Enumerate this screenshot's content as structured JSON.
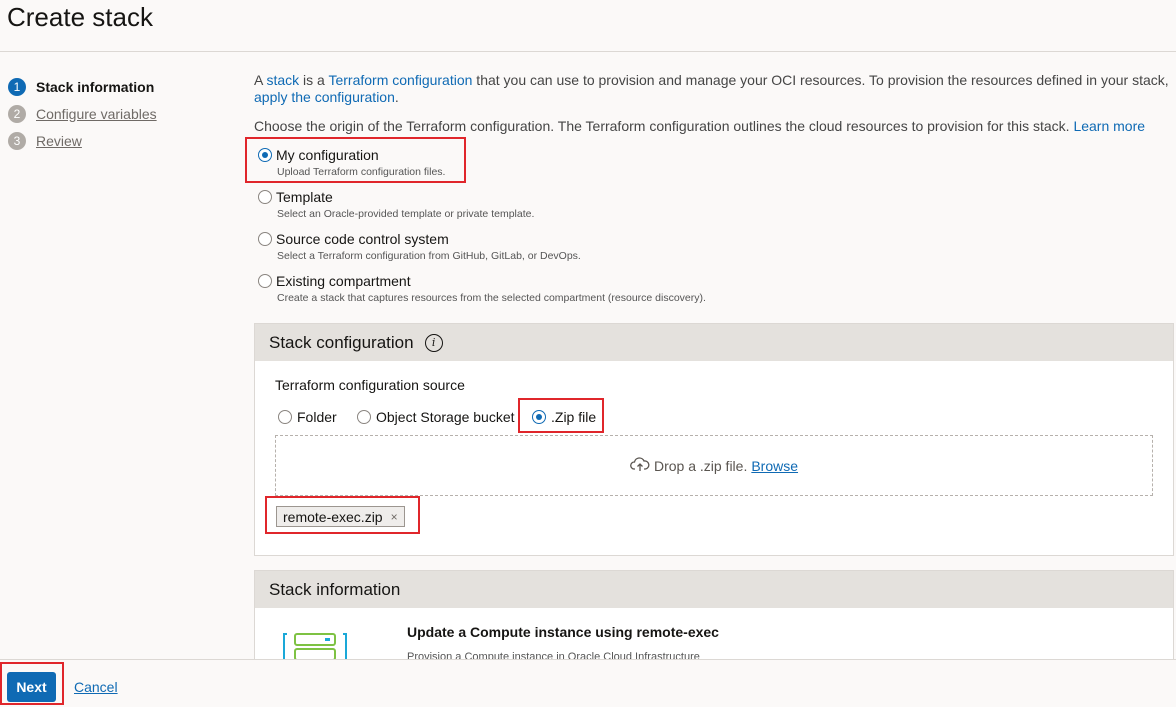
{
  "page": {
    "title": "Create stack"
  },
  "steps": [
    {
      "num": "1",
      "label": "Stack information"
    },
    {
      "num": "2",
      "label": "Configure variables"
    },
    {
      "num": "3",
      "label": "Review"
    }
  ],
  "intro": {
    "t1": "A ",
    "link_stack": "stack",
    "t2": " is a ",
    "link_terraform": "Terraform configuration",
    "t3": " that you can use to provision and manage your OCI resources. To provision the resources defined in your stack,",
    "link_apply": "apply the configuration",
    "t4": "."
  },
  "origin": {
    "text": "Choose the origin of the Terraform configuration. The Terraform configuration outlines the cloud resources to provision for this stack. ",
    "learn_more": "Learn more",
    "options": [
      {
        "title": "My configuration",
        "desc": "Upload Terraform configuration files.",
        "checked": true
      },
      {
        "title": "Template",
        "desc": "Select an Oracle-provided template or private template.",
        "checked": false
      },
      {
        "title": "Source code control system",
        "desc": "Select a Terraform configuration from GitHub, GitLab, or DevOps.",
        "checked": false
      },
      {
        "title": "Existing compartment",
        "desc": "Create a stack that captures resources from the selected compartment (resource discovery).",
        "checked": false
      }
    ]
  },
  "stack_config": {
    "header": "Stack configuration",
    "info_icon": "i",
    "source_label": "Terraform configuration source",
    "sources": [
      {
        "label": "Folder",
        "checked": false
      },
      {
        "label": "Object Storage bucket",
        "checked": false
      },
      {
        "label": ".Zip file",
        "checked": true
      }
    ],
    "drop_text": "Drop a .zip file.",
    "browse": "Browse",
    "file_name": "remote-exec.zip",
    "file_remove": "×"
  },
  "stack_info": {
    "header": "Stack information",
    "template_title": "Update a Compute instance using remote-exec",
    "template_desc": "Provision a Compute instance in Oracle Cloud Infrastructure"
  },
  "footer": {
    "next": "Next",
    "cancel": "Cancel"
  },
  "colors": {
    "accent": "#0f6ab4",
    "highlight": "#e0262b"
  }
}
